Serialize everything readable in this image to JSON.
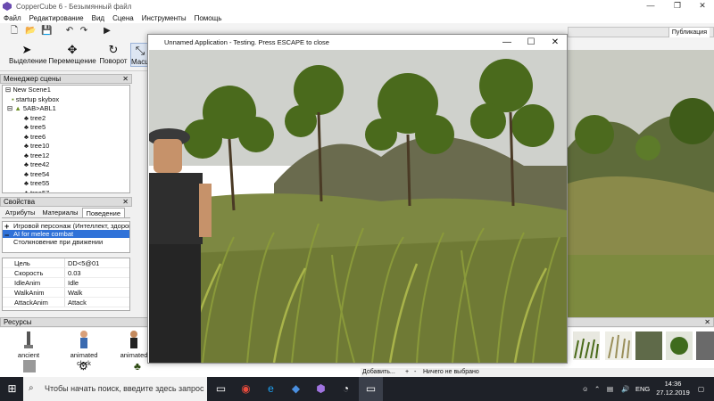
{
  "app": {
    "title": "CopperCube 6 - Безымянный файл"
  },
  "menu": [
    "Файл",
    "Редактирование",
    "Вид",
    "Сцена",
    "Инструменты",
    "Помощь"
  ],
  "toolbar": {
    "select": "Выделение",
    "move": "Перемещение",
    "rotate": "Поворот",
    "scale": "Масш"
  },
  "scene_manager": {
    "title": "Менеджер сцены",
    "items": [
      "New Scene1",
      "startup skybox",
      "5AB>ABL1",
      "tree2",
      "tree5",
      "tree6",
      "tree10",
      "tree12",
      "tree42",
      "tree54",
      "tree55",
      "tree57"
    ]
  },
  "properties": {
    "title": "Свойства",
    "tabs": [
      "Атрибуты",
      "Материалы",
      "Поведение"
    ],
    "behaviors": [
      "Игровой персонаж (Интеллект, здоров",
      "AI for melee combat",
      "Столкновение при движении"
    ],
    "rows": [
      {
        "k": "Цель",
        "v": "DD<5@01"
      },
      {
        "k": "Скорость",
        "v": "0.03"
      },
      {
        "k": "IdleAnim",
        "v": "Idle"
      },
      {
        "k": "WalkAnim",
        "v": "Walk"
      },
      {
        "k": "AttackAnim",
        "v": "Attack"
      }
    ]
  },
  "resources": {
    "title": "Ресурсы",
    "items": [
      "ancient",
      "animated clerk",
      "animated"
    ]
  },
  "right_tabs": {
    "active": "Публикация"
  },
  "status": {
    "add": "Добавить...",
    "plus": "+",
    "minus": "-",
    "selection": "Ничего не выбрано"
  },
  "game_window": {
    "title": "Unnamed Application - Testing. Press ESCAPE to close"
  },
  "taskbar": {
    "search_placeholder": "Чтобы начать поиск, введите здесь запрос",
    "lang": "ENG",
    "time": "14:36",
    "date": "27.12.2019"
  }
}
